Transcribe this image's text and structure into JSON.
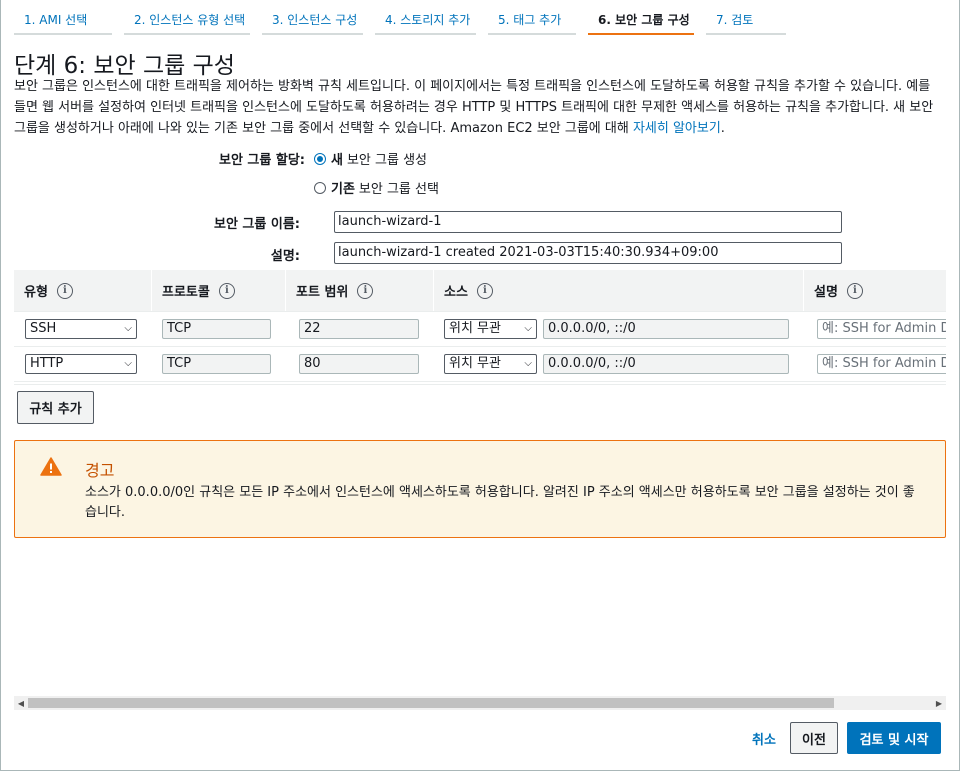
{
  "wizard_tabs": [
    {
      "label": "1. AMI 선택"
    },
    {
      "label": "2. 인스턴스 유형 선택"
    },
    {
      "label": "3. 인스턴스 구성"
    },
    {
      "label": "4. 스토리지 추가"
    },
    {
      "label": "5. 태그 추가"
    },
    {
      "label": "6. 보안 그룹 구성"
    },
    {
      "label": "7. 검토"
    }
  ],
  "page_title": "단계 6: 보안 그룹 구성",
  "description": {
    "text": "보안 그룹은 인스턴스에 대한 트래픽을 제어하는 방화벽 규칙 세트입니다. 이 페이지에서는 특정 트래픽을 인스턴스에 도달하도록 허용할 규칙을 추가할 수 있습니다. 예를 들면 웹 서버를 설정하여 인터넷 트래픽을 인스턴스에 도달하도록 허용하려는 경우 HTTP 및 HTTPS 트래픽에 대한 무제한 액세스를 허용하는 규칙을 추가합니다. 새 보안 그룹을 생성하거나 아래에 나와 있는 기존 보안 그룹 중에서 선택할 수 있습니다. Amazon EC2 보안 그룹에 대해 ",
    "link": "자세히 알아보기",
    "end": "."
  },
  "form": {
    "assign_label": "보안 그룹 할당:",
    "option_new_bold": "새",
    "option_new_rest": "보안 그룹 생성",
    "option_existing_bold": "기존",
    "option_existing_rest": "보안 그룹 선택",
    "selected_option": "new",
    "name_label": "보안 그룹 이름:",
    "name_value": "launch-wizard-1",
    "desc_label": "설명:",
    "desc_value": "launch-wizard-1 created 2021-03-03T15:40:30.934+09:00"
  },
  "rules_table": {
    "headers": {
      "type": "유형",
      "protocol": "프로토콜",
      "port_range": "포트 범위",
      "source": "소스",
      "description": "설명"
    },
    "info_glyph": "i",
    "rows": [
      {
        "type": "SSH",
        "protocol": "TCP",
        "port": "22",
        "source_select": "위치 무관",
        "source_value": "0.0.0.0/0, ::/0",
        "desc_placeholder": "예: SSH for Admin Desktop"
      },
      {
        "type": "HTTP",
        "protocol": "TCP",
        "port": "80",
        "source_select": "위치 무관",
        "source_value": "0.0.0.0/0, ::/0",
        "desc_placeholder": "예: SSH for Admin Desktop"
      }
    ]
  },
  "add_rule_button": "규칙 추가",
  "warning": {
    "title": "경고",
    "body": "소스가 0.0.0.0/0인 규칙은 모든 IP 주소에서 인스턴스에 액세스하도록 허용합니다. 알려진 IP 주소의 액세스만 허용하도록 보안 그룹을 설정하는 것이 좋습니다."
  },
  "footer": {
    "cancel": "취소",
    "previous": "이전",
    "review_launch": "검토 및 시작"
  },
  "colors": {
    "link": "#0073bb",
    "active_tab": "#ec7211",
    "warning_border": "#ec7211",
    "warning_bg": "#fcf5e3",
    "primary_button": "#0073bb"
  }
}
